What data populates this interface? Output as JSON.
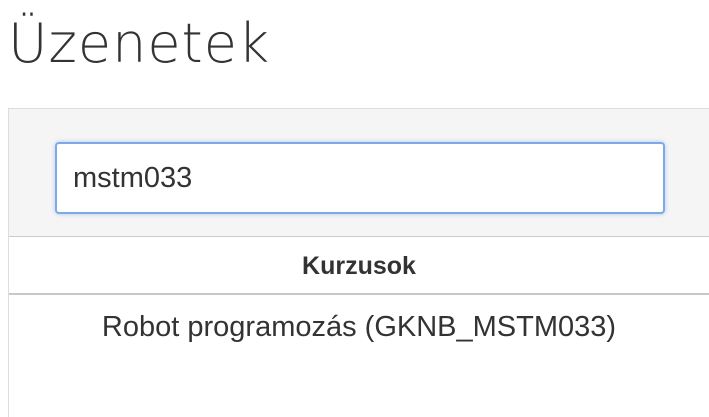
{
  "page": {
    "title": "Üzenetek"
  },
  "search": {
    "value": "mstm033",
    "placeholder": ""
  },
  "courses_table": {
    "header": "Kurzusok",
    "rows": [
      {
        "label": "Robot programozás (GKNB_MSTM033)"
      }
    ]
  },
  "colors": {
    "input_focus_border": "#7fa9e6",
    "search_area_bg": "#f5f5f5",
    "text": "#333333"
  }
}
